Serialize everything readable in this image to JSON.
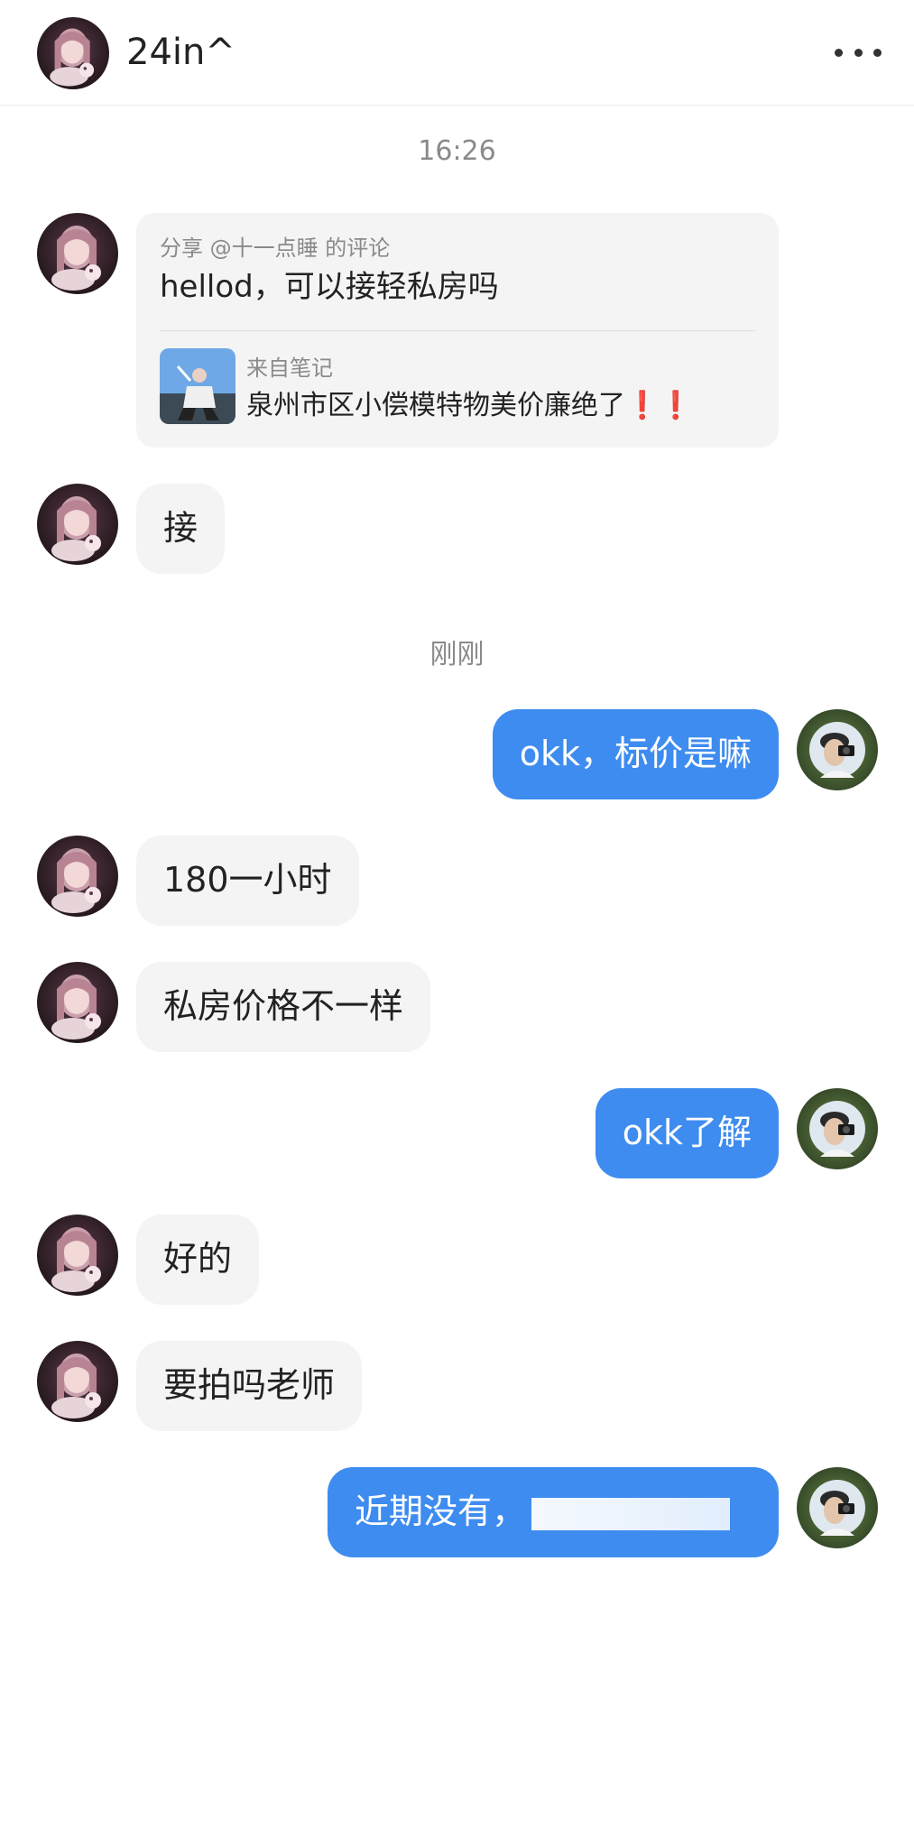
{
  "header": {
    "title": "24in^",
    "avatar_icon": "female-avatar-icon",
    "more_icon": "more-horizontal-icon"
  },
  "timestamps": [
    "16:26",
    "刚刚"
  ],
  "share_card": {
    "header": "分享 @十一点睡 的评论",
    "comment": "hellod，可以接轻私房吗",
    "source_label": "来自笔记",
    "note_title": "泉州市区小偿模特物美价廉绝了",
    "note_title_emoji": "❗❗",
    "thumbnail_icon": "note-thumbnail-icon"
  },
  "messages": [
    {
      "side": "in",
      "text": "接"
    },
    {
      "side": "out",
      "text": "okk，标价是嘛"
    },
    {
      "side": "in",
      "text": "180一小时"
    },
    {
      "side": "in",
      "text": "私房价格不一样"
    },
    {
      "side": "out",
      "text": "okk了解"
    },
    {
      "side": "in",
      "text": "好的"
    },
    {
      "side": "in",
      "text": "要拍吗老师"
    },
    {
      "side": "out",
      "text": "近期没有，"
    }
  ],
  "colors": {
    "outgoing_bubble": "#3e8cf0",
    "incoming_bubble": "#f4f4f4",
    "timestamp": "#8a8a8a",
    "emoji_red": "#e0303a"
  }
}
